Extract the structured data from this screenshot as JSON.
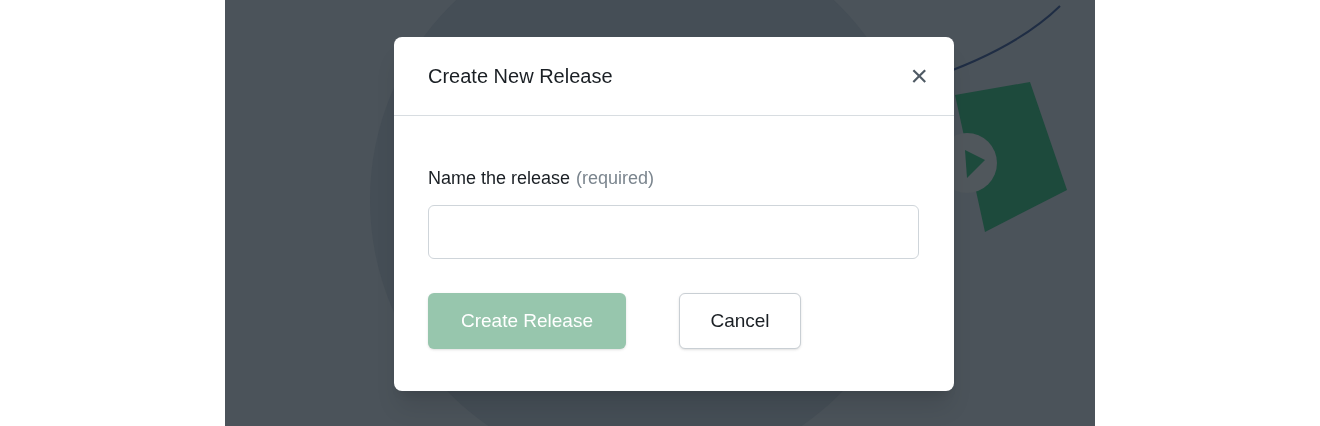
{
  "dialog": {
    "title": "Create New Release",
    "close_label": "×",
    "field": {
      "label": "Name the release",
      "hint": "(required)"
    },
    "buttons": [
      {
        "kind": "primary",
        "label": "Create Release",
        "disabled": true
      },
      {
        "kind": "secondary",
        "label": "Cancel",
        "disabled": false
      }
    ]
  }
}
